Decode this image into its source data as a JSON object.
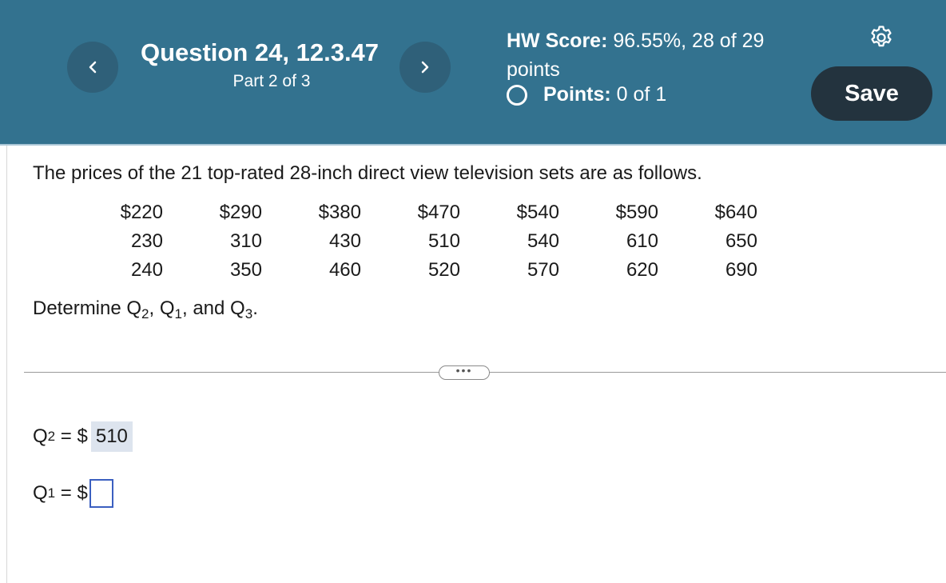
{
  "header": {
    "question_title": "Question 24, 12.3.47",
    "part": "Part 2 of 3",
    "hw_score_label": "HW Score:",
    "hw_score_value": "96.55%, 28 of 29 points",
    "points_label": "Points:",
    "points_value": "0 of 1",
    "save_label": "Save",
    "prev_icon": "chevron-left-icon",
    "next_icon": "chevron-right-icon",
    "settings_icon": "gear-icon"
  },
  "problem": {
    "text": "The prices of the 21 top-rated 28-inch direct view television sets are as follows.",
    "prices": [
      [
        "$220",
        "$290",
        "$380",
        "$470",
        "$540",
        "$590",
        "$640"
      ],
      [
        "230",
        "310",
        "430",
        "510",
        "540",
        "610",
        "650"
      ],
      [
        "240",
        "350",
        "460",
        "520",
        "570",
        "620",
        "690"
      ]
    ],
    "determine_prefix": "Determine Q",
    "determine_q2_sub": "2",
    "determine_mid1": ", Q",
    "determine_q1_sub": "1",
    "determine_mid2": ", and Q",
    "determine_q3_sub": "3",
    "determine_suffix": "."
  },
  "answers": {
    "q2_letter": "Q",
    "q2_sub": "2",
    "q2_eq": " = $",
    "q2_value": "510",
    "q1_letter": "Q",
    "q1_sub": "1",
    "q1_eq": " = $",
    "q1_value": ""
  },
  "more_button_label": "•••"
}
